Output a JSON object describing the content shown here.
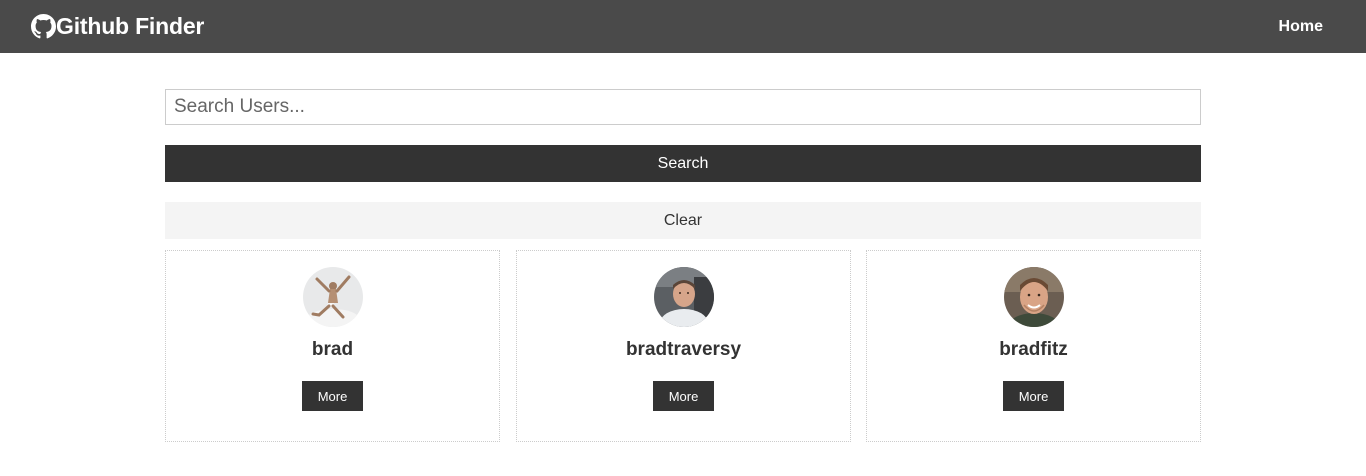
{
  "navbar": {
    "brand_icon": "github-icon",
    "title": "Github Finder",
    "home_link": "Home",
    "background": "#4a4a4a"
  },
  "search": {
    "placeholder": "Search Users...",
    "value": "",
    "search_button": "Search",
    "clear_button": "Clear"
  },
  "users": [
    {
      "login": "brad",
      "more_label": "More",
      "avatar": "avatar-brad"
    },
    {
      "login": "bradtraversy",
      "more_label": "More",
      "avatar": "avatar-bradtraversy"
    },
    {
      "login": "bradfitz",
      "more_label": "More",
      "avatar": "avatar-bradfitz"
    }
  ],
  "colors": {
    "dark": "#333333",
    "light": "#f4f4f4"
  }
}
